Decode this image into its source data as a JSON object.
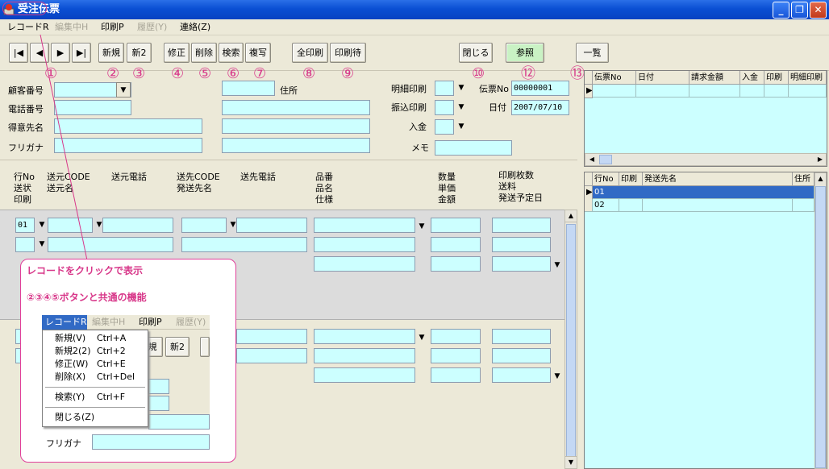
{
  "window": {
    "title": "受注伝票"
  },
  "menu": {
    "items": [
      "レコードR",
      "編集中H",
      "印刷P",
      "履歴(Y)",
      "連絡(Z)"
    ]
  },
  "toolbar": {
    "first": "|◀",
    "prev": "◀",
    "next": "▶",
    "last": "▶|",
    "new": "新規",
    "new2": "新2",
    "edit": "修正",
    "delete": "削除",
    "search": "検索",
    "copy": "複写",
    "print_all": "全印刷",
    "print_wait": "印刷待",
    "close": "閉じる",
    "ref": "参照",
    "list": "一覧"
  },
  "markers": [
    "①",
    "②",
    "③",
    "④",
    "⑤",
    "⑥",
    "⑦",
    "⑧",
    "⑨",
    "⑩",
    "⑫",
    "⑬"
  ],
  "form": {
    "customer_no": "顧客番号",
    "phone": "電話番号",
    "customer_name": "得意先名",
    "furigana": "フリガナ",
    "address": "住所",
    "detail_print": "明細印刷",
    "transfer_print": "振込印刷",
    "deposit": "入金",
    "memo": "メモ",
    "slip_no_label": "伝票No",
    "slip_no": "00000001",
    "date_label": "日付",
    "date": "2007/07/10"
  },
  "detail_header": {
    "c1": "行No\n送状\n印刷",
    "c2": "送元CODE\n送元名",
    "c3": "送元電話",
    "c4": "送先CODE\n発送先名",
    "c5": "送先電話",
    "c6": "品番\n品名\n仕様",
    "c7": "数量\n単価\n金額",
    "c8": "印刷枚数\n送料\n発送予定日"
  },
  "detail_row": {
    "line": "01"
  },
  "right_grid": {
    "headers": [
      "伝票No",
      "日付",
      "請求金額",
      "入金",
      "印刷",
      "明細印刷"
    ]
  },
  "right_grid2": {
    "headers": [
      "行No",
      "印刷",
      "発送先名",
      "住所"
    ],
    "rows": [
      "01",
      "02"
    ]
  },
  "annotation": {
    "line1": "レコードをクリックで表示",
    "line2": "②③④⑤ボタンと共通の機能"
  },
  "popup_menu": {
    "bar": [
      "レコードR",
      "編集中H",
      "印刷P",
      "履歴(Y)"
    ],
    "items": [
      {
        "label": "新規(V)",
        "key": "Ctrl+A"
      },
      {
        "label": "新規2(2)",
        "key": "Ctrl+2"
      },
      {
        "label": "修正(W)",
        "key": "Ctrl+E"
      },
      {
        "label": "削除(X)",
        "key": "Ctrl+Del"
      },
      {
        "label": "検索(Y)",
        "key": "Ctrl+F"
      },
      {
        "label": "閉じる(Z)",
        "key": ""
      }
    ]
  },
  "popup_bg": {
    "new_label": "規",
    "new2": "新2",
    "furigana": "フリガナ"
  },
  "colors": {
    "field": "#ccffff",
    "accent": "#d8388a",
    "title": "#0a4fd3"
  }
}
